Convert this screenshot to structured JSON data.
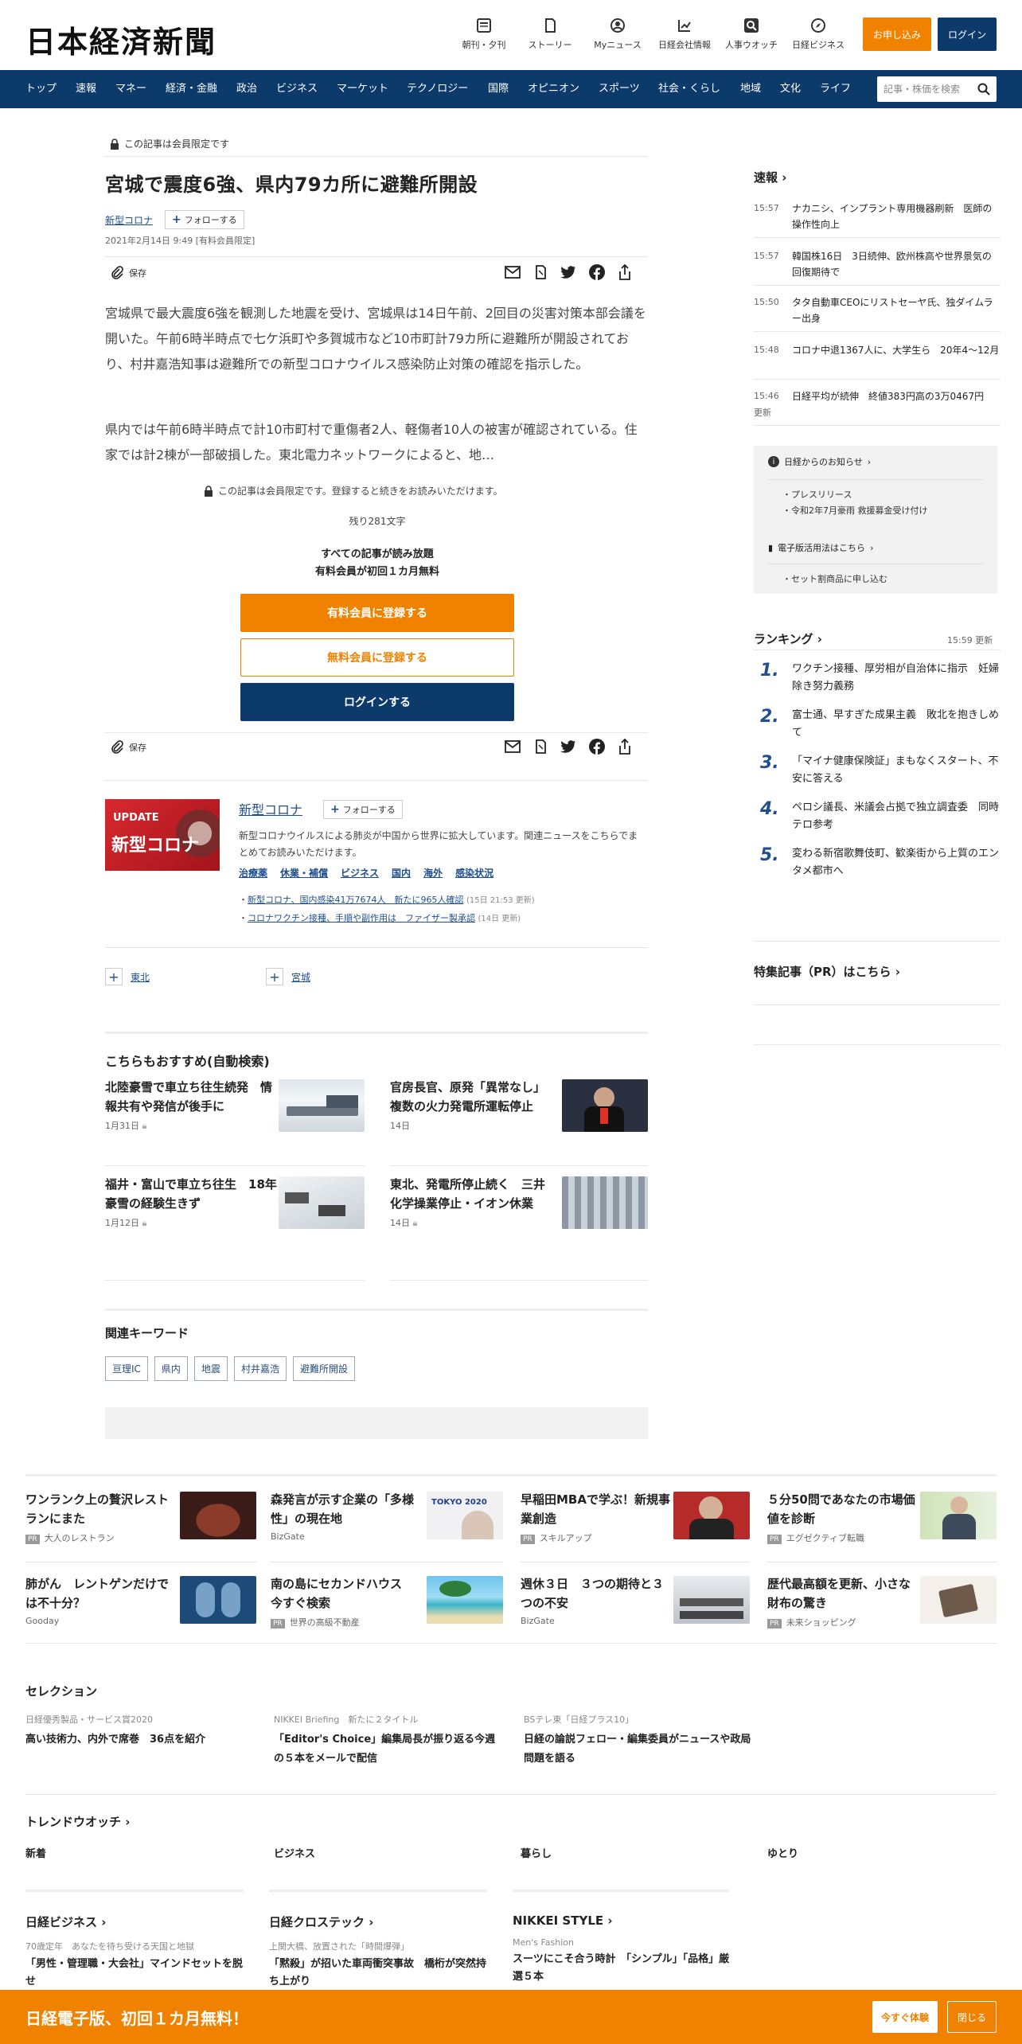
{
  "header": {
    "logo": "日本経済新聞",
    "nav": [
      {
        "label": "朝刊・夕刊",
        "icon": "newspaper-icon"
      },
      {
        "label": "ストーリー",
        "icon": "story-icon"
      },
      {
        "label": "Myニュース",
        "icon": "user-icon"
      },
      {
        "label": "日経会社情報",
        "icon": "chart-icon"
      },
      {
        "label": "人事ウオッチ",
        "icon": "search-person-icon"
      },
      {
        "label": "日経ビジネス",
        "icon": "compass-icon"
      }
    ],
    "apply_label": "お申し込み",
    "login_label": "ログイン"
  },
  "global_nav": [
    "トップ",
    "速報",
    "マネー",
    "経済・金融",
    "政治",
    "ビジネス",
    "マーケット",
    "テクノロジー",
    "国際",
    "オピニオン",
    "スポーツ",
    "社会・くらし",
    "地域",
    "文化",
    "ライフ"
  ],
  "search": {
    "placeholder": "記事・株価を検索"
  },
  "article": {
    "members_only": "この記事は会員限定です",
    "title": "宮城で震度6強、県内79カ所に避難所開設",
    "topic": "新型コロナ",
    "follow_label": "フォローする",
    "date": "2021年2月14日 9:49 [有料会員限定]",
    "save_label": "保存",
    "para1": "宮城県で最大震度6強を観測した地震を受け、宮城県は14日午前、2回目の災害対策本部会議を開いた。午前6時半時点で七ケ浜町や多賀城市など10市町計79カ所に避難所が開設されており、村井嘉浩知事は避難所での新型コロナウイルス感染防止対策の確認を指示した。",
    "para2": "県内では午前6時半時点で計10市町村で重傷者2人、軽傷者10人の被害が確認されている。住家では計2棟が一部破損した。東北電力ネットワークによると、地…",
    "paywall_note": "この記事は会員限定です。登録すると続きをお読みいただけます。",
    "remaining": "残り281文字",
    "all_read": "すべての記事が読み放題",
    "first_month": "有料会員が初回１カ月無料",
    "paid_register": "有料会員に登録する",
    "free_register": "無料会員に登録する",
    "login_btn": "ログインする"
  },
  "topic_box": {
    "banner_top": "UPDATE",
    "banner_main": "新型コロナ",
    "name": "新型コロナ",
    "follow_label": "フォローする",
    "desc": "新型コロナウイルスによる肺炎が中国から世界に拡大しています。関連ニュースをこちらでまとめてお読みいただけます。",
    "links": [
      "治療薬",
      "休業・補償",
      "ビジネス",
      "国内",
      "海外",
      "感染状況"
    ],
    "news": [
      {
        "text": "新型コロナ、国内感染41万7674人　新たに965人確認",
        "time": "(15日 21:53 更新)"
      },
      {
        "text": "コロナワクチン接種、手順や副作用は　ファイザー製承認",
        "time": "(14日 更新)"
      }
    ]
  },
  "follow_regions": [
    "東北",
    "宮城"
  ],
  "recommend": {
    "heading": "こちらもおすすめ(自動検索)",
    "items": [
      {
        "title": "北陸豪雪で車立ち往生続発　情報共有や発信が後手に",
        "date": "1月31日"
      },
      {
        "title": "官房長官、原発「異常なし」　複数の火力発電所運転停止",
        "date": "14日"
      },
      {
        "title": "福井・富山で車立ち往生　18年豪雪の経験生きず",
        "date": "1月12日"
      },
      {
        "title": "東北、発電所停止続く　三井化学操業停止・イオン休業",
        "date": "14日"
      }
    ]
  },
  "keywords": {
    "heading": "関連キーワード",
    "items": [
      "亘理IC",
      "県内",
      "地震",
      "村井嘉浩",
      "避難所開設"
    ]
  },
  "sidebar": {
    "breaking_heading": "速報",
    "breaking": [
      {
        "time": "15:57",
        "text": "ナカニシ、インプラント専用機器刷新　医師の操作性向上"
      },
      {
        "time": "15:57",
        "text": "韓国株16日　3日続伸、欧州株高や世界景気の回復期待で"
      },
      {
        "time": "15:50",
        "text": "タタ自動車CEOにリストセーヤ氏、独ダイムラー出身"
      },
      {
        "time": "15:48",
        "text": "コロナ中退1367人に、大学生ら　20年4～12月"
      },
      {
        "time": "15:46",
        "text": "日経平均が続伸　終値383円高の3万0467円"
      }
    ],
    "more_label": "更新",
    "notice_heading": "日経からのお知らせ",
    "notices": [
      "プレスリリース",
      "令和2年7月豪雨 救援募金受け付け"
    ],
    "ebook_heading": "電子版活用法はこちら",
    "ebook_items": [
      "セット割商品に申し込む"
    ],
    "ranking_heading": "ランキング",
    "ranking_time": "15:59  更新",
    "ranking": [
      {
        "n": "1.",
        "text": "ワクチン接種、厚労相が自治体に指示　妊婦除き努力義務"
      },
      {
        "n": "2.",
        "text": "富士通、早すぎた成果主義　敗北を抱きしめて"
      },
      {
        "n": "3.",
        "text": "「マイナ健康保険証」まもなくスタート、不安に答える"
      },
      {
        "n": "4.",
        "text": "ペロシ議長、米議会占拠で独立調査委　同時テロ参考"
      },
      {
        "n": "5.",
        "text": "変わる新宿歌舞伎町、歓楽街から上質のエンタメ都市へ"
      }
    ],
    "pr_heading": "特集記事（PR）はこちら"
  },
  "ads": [
    {
      "title": "ワンランク上の贅沢レストランにまた",
      "source": "大人のレストラン",
      "pr": true
    },
    {
      "title": "森発言が示す企業の「多様性」の現在地",
      "source": "BizGate",
      "pr": false
    },
    {
      "title": "早稲田MBAで学ぶ！新規事業創造",
      "source": "スキルアップ",
      "pr": true
    },
    {
      "title": "５分50問であなたの市場価値を診断",
      "source": "エグゼクティブ転職",
      "pr": true
    },
    {
      "title": "肺がん　レントゲンだけでは不十分？",
      "source": "Gooday",
      "pr": false
    },
    {
      "title": "南の島にセカンドハウス　今すぐ検索",
      "source": "世界の高級不動産",
      "pr": true
    },
    {
      "title": "週休３日　３つの期待と３つの不安",
      "source": "BizGate",
      "pr": false
    },
    {
      "title": "歴代最高額を更新、小さな財布の驚き",
      "source": "未来ショッピング",
      "pr": true
    }
  ],
  "selection": {
    "heading": "セレクション",
    "items": [
      {
        "label": "日経優秀製品・サービス賞2020",
        "text": "高い技術力、内外で席巻　36点を紹介"
      },
      {
        "label": "NIKKEI Briefing　新たに２タイトル",
        "text": "「Editor's Choice」編集局長が振り返る今週の５本をメールで配信"
      },
      {
        "label": "BSテレ東「日経プラス10」",
        "text": "日経の論説フェロー・編集委員がニュースや政局問題を語る"
      }
    ]
  },
  "trend": {
    "heading": "トレンドウオッチ",
    "tabs": [
      "新着",
      "ビジネス",
      "暮らし",
      "ゆとり"
    ]
  },
  "media": [
    {
      "name": "日経ビジネス",
      "label": "70歳定年　あなたを待ち受ける天国と地獄",
      "text": "「男性・管理職・大会社」マインドセットを脱せ"
    },
    {
      "name": "日経クロステック",
      "label": "上関大橋、放置された「時間爆弾」",
      "text": "「黙殺」が招いた車両衝突事故　橋桁が突然持ち上がり"
    },
    {
      "name": "NIKKEI STYLE",
      "label": "Men's Fashion",
      "text": "スーツにこそ合う時計　「シンプル」「品格」厳選５本"
    }
  ],
  "bottom_bar": {
    "text": "日経電子版、初回１カ月無料！",
    "try_label": "今すぐ体験",
    "close_label": "閉じる"
  },
  "colors": {
    "navy": "#0b3a6b",
    "orange": "#f08200"
  }
}
